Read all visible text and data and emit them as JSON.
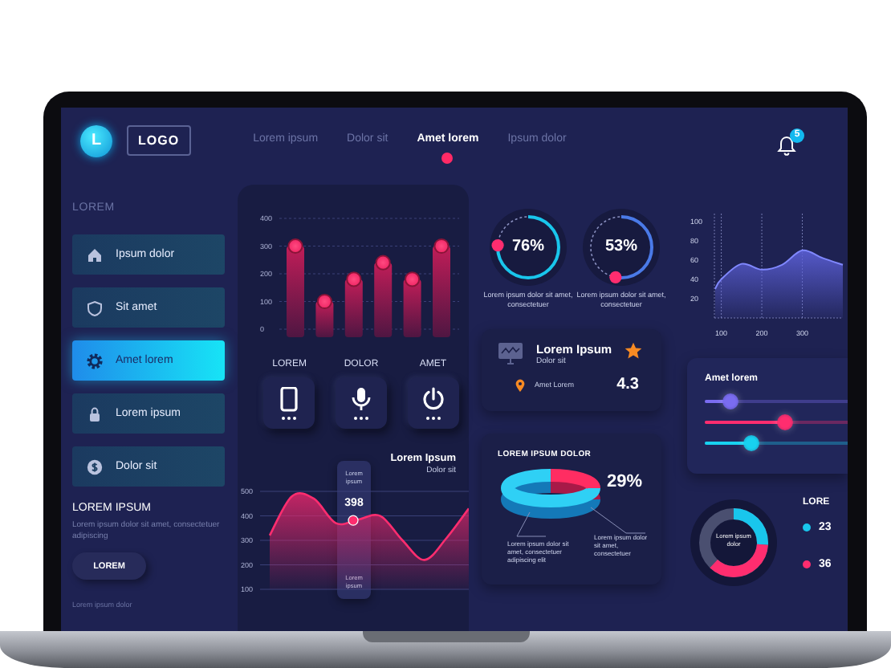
{
  "topbar": {
    "logo_mark": "L",
    "logo": "LOGO",
    "tabs": [
      {
        "label": "Lorem ipsum",
        "selected": false
      },
      {
        "label": "Dolor sit",
        "selected": false
      },
      {
        "label": "Amet lorem",
        "selected": true
      },
      {
        "label": "Ipsum dolor",
        "selected": false
      }
    ],
    "notifications": "5"
  },
  "sidebar": {
    "heading": "LOREM",
    "items": [
      {
        "label": "Ipsum dolor",
        "selected": false
      },
      {
        "label": "Sit amet",
        "selected": false
      },
      {
        "label": "Amet lorem",
        "selected": true
      },
      {
        "label": "Lorem ipsum",
        "selected": false
      },
      {
        "label": "Dolor sit",
        "selected": false
      }
    ],
    "promo": {
      "title": "LOREM IPSUM",
      "text": "Lorem ipsum dolor sit amet, consectetuer adipiscing",
      "button": "LOREM"
    },
    "footer": "Lorem ipsum dolor"
  },
  "bar_chart": {
    "chart_data": {
      "type": "bar",
      "values": [
        300,
        100,
        180,
        240,
        180,
        300
      ],
      "ylim": [
        0,
        400
      ],
      "yticks": [
        0,
        100,
        200,
        300,
        400
      ],
      "grid": true
    }
  },
  "devices": [
    {
      "label": "LOREM"
    },
    {
      "label": "DOLOR"
    },
    {
      "label": "AMET"
    }
  ],
  "wave_card": {
    "title": "Lorem Ipsum",
    "subtitle": "Dolor sit",
    "chart_data": {
      "type": "area",
      "values": [
        320,
        480,
        470,
        370,
        385,
        400,
        300,
        220,
        310,
        430
      ],
      "ylim": [
        100,
        500
      ],
      "yticks": [
        100,
        200,
        300,
        400,
        500
      ],
      "grid": true
    },
    "tooltip": {
      "top": "Lorem ipsum",
      "value": "398",
      "bottom": "Lorem ipsum"
    }
  },
  "gauges": [
    {
      "value": "76%",
      "level": 0.76,
      "caption": "Lorem ipsum dolor sit amet, consectetuer"
    },
    {
      "value": "53%",
      "level": 0.53,
      "caption": "Lorem ipsum dolor sit amet, consectetuer"
    }
  ],
  "rating_card": {
    "title": "Lorem Ipsum",
    "subtitle": "Dolor sit",
    "location": "Amet Lorem",
    "rating": "4.3"
  },
  "ring_card": {
    "title": "LOREM IPSUM DOLOR",
    "value": "29%",
    "captions": [
      "Lorem ipsum dolor sit amet, consectetuer adipiscing elit",
      "Lorem ipsum dolor sit amet, consectetuer"
    ]
  },
  "area_chart": {
    "chart_data": {
      "type": "area",
      "x": [
        85,
        100,
        150,
        200,
        250,
        300,
        350,
        400
      ],
      "values": [
        30,
        40,
        56,
        50,
        55,
        70,
        62,
        55
      ],
      "xlim": [
        83,
        400
      ],
      "ylim": [
        0,
        108
      ],
      "xticks": [
        100,
        200,
        300
      ],
      "yticks": [
        20,
        40,
        60,
        80,
        100
      ],
      "grid": true
    }
  },
  "sliders": {
    "title": "Amet lorem",
    "items": [
      {
        "level": 0.18,
        "color": "#7a6cf0"
      },
      {
        "level": 0.56,
        "color": "#ff2d6f"
      },
      {
        "level": 0.33,
        "color": "#18d2f0"
      }
    ]
  },
  "donut": {
    "center": "Lorem ipsum dolor",
    "legend_title": "LORE",
    "legend": [
      {
        "value": "23",
        "color": "#19c6ec"
      },
      {
        "value": "36",
        "color": "#ff2d6f"
      }
    ]
  }
}
